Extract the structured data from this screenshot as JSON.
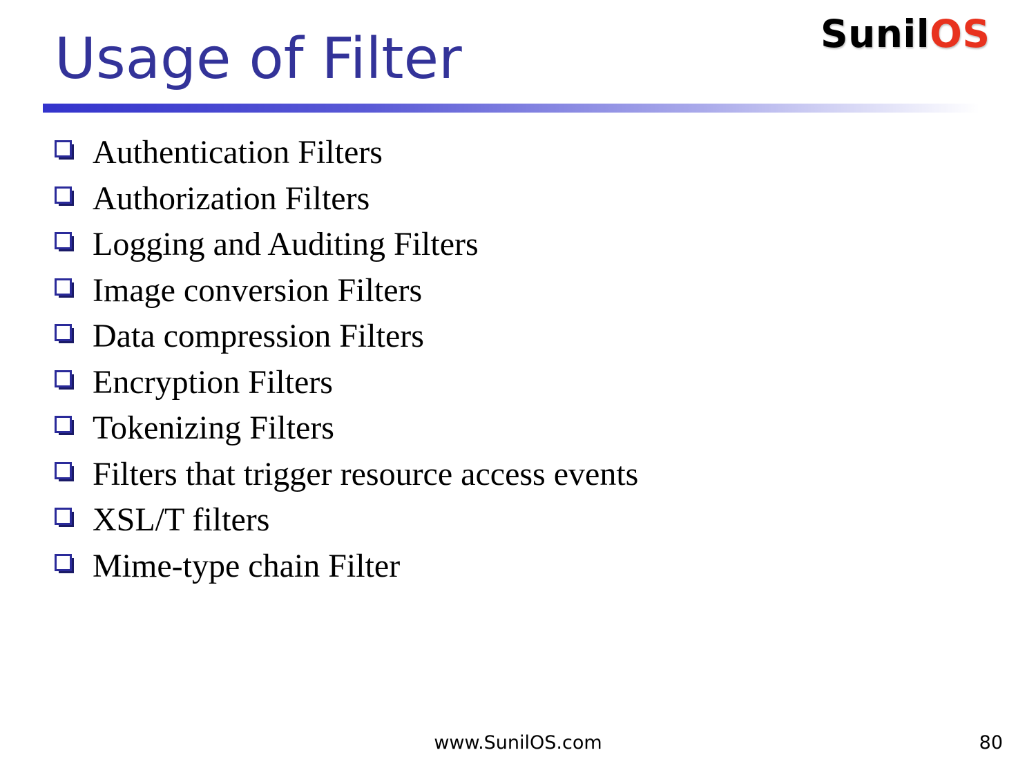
{
  "slide": {
    "title": "Usage of Filter",
    "logo": {
      "part1": "Sunil",
      "part2": "OS"
    },
    "bullets": [
      {
        "text": "Authentication Filters"
      },
      {
        "text": "Authorization Filters"
      },
      {
        "text": "Logging and Auditing Filters"
      },
      {
        "text": "Image conversion Filters"
      },
      {
        "text": "Data compression Filters"
      },
      {
        "text": "Encryption Filters"
      },
      {
        "text": "Tokenizing Filters"
      },
      {
        "text": "Filters that trigger resource access events"
      },
      {
        "text": "XSL/T filters"
      },
      {
        "text": "Mime-type chain Filter"
      }
    ],
    "footer": {
      "url": "www.SunilOS.com",
      "page_number": "80"
    },
    "bullet_icon": "checkbox-icon",
    "colors": {
      "title": "#333399",
      "logo_dark": "#000000",
      "logo_accent": "#e8321e",
      "rule_start": "#3333cc"
    }
  }
}
